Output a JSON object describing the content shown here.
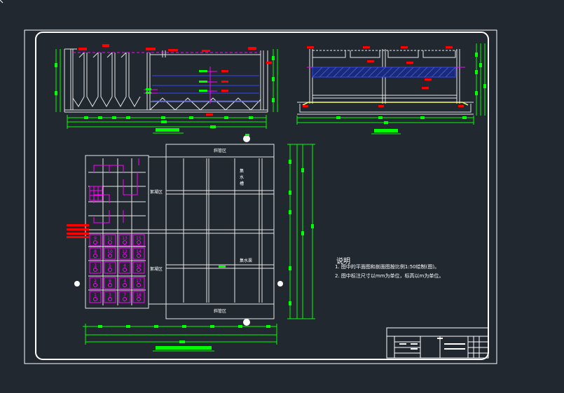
{
  "drawing": {
    "background": "#212830",
    "line_colors": {
      "frame": "#ffffff",
      "structure": "#e6e6e6",
      "dimension": "#00ff00",
      "leader": "#ff00ff",
      "tag": "#ff0000",
      "hatch": "#2233aa",
      "pipe": "#ffff66"
    }
  },
  "notes": {
    "title": "说明",
    "line1": "1. 图中的平面图和剖面图按比例1:50绘制(图)。",
    "line2": "2. 图中标注尺寸以mm为单位，标高以m为单位。"
  },
  "plan": {
    "zone_top": "斜管区",
    "zone_bottom": "斜管区",
    "zone_left_upper": "絮凝区",
    "zone_left_lower": "絮凝区",
    "label_mid_upper": "集水槽",
    "label_mid_lower": "集水渠"
  },
  "cells": [
    "9",
    "11",
    "13",
    "15",
    "8",
    "10",
    "12",
    "14",
    "3",
    "5",
    "4",
    "16",
    "2",
    "6",
    "4",
    "17",
    "1",
    "3",
    "7",
    "18"
  ]
}
